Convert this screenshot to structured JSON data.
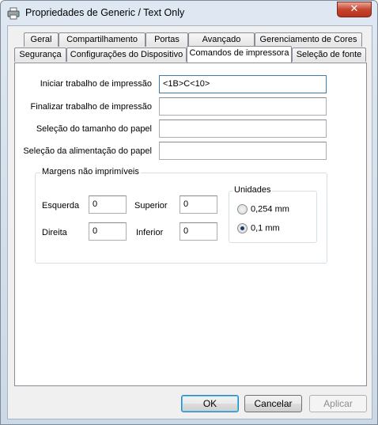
{
  "window": {
    "title": "Propriedades de Generic / Text Only",
    "close_glyph": "✕"
  },
  "tabs_row1": [
    "Geral",
    "Compartilhamento",
    "Portas",
    "Avançado",
    "Gerenciamento de Cores"
  ],
  "tabs_row2": [
    "Segurança",
    "Configurações do Dispositivo",
    "Comandos de impressora",
    "Seleção de fonte"
  ],
  "fields": {
    "start_job": {
      "label": "Iniciar trabalho de impressão",
      "value": "<1B>C<10>"
    },
    "end_job": {
      "label": "Finalizar trabalho de impressão",
      "value": ""
    },
    "paper_size": {
      "label": "Seleção do tamanho do papel",
      "value": ""
    },
    "paper_feed": {
      "label": "Seleção da alimentação do papel",
      "value": ""
    }
  },
  "margins": {
    "caption": "Margens não imprimíveis",
    "left": {
      "label": "Esquerda",
      "value": "0"
    },
    "top": {
      "label": "Superior",
      "value": "0"
    },
    "right": {
      "label": "Direita",
      "value": "0"
    },
    "bottom": {
      "label": "Inferior",
      "value": "0"
    }
  },
  "units": {
    "caption": "Unidades",
    "options": [
      {
        "label": "0,254 mm",
        "checked": false
      },
      {
        "label": "0,1 mm",
        "checked": true
      }
    ]
  },
  "buttons": {
    "ok": "OK",
    "cancel": "Cancelar",
    "apply": "Aplicar"
  }
}
